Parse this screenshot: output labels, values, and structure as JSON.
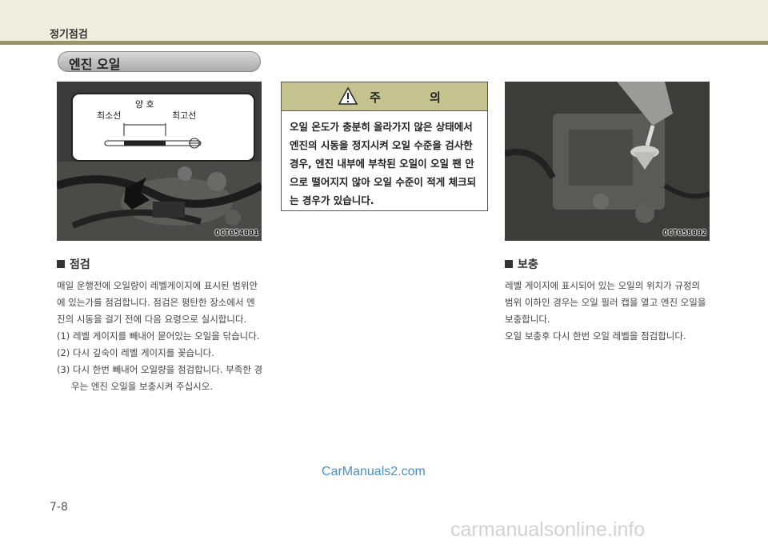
{
  "header": {
    "title": "정기점검"
  },
  "section": {
    "title": "엔진 오일"
  },
  "left_photo": {
    "code": "OCT054001",
    "inset_label_good": "양 호",
    "inset_label_min": "최소선",
    "inset_label_max": "최고선"
  },
  "caution": {
    "title": "주 의",
    "text": "오일 온도가 충분히 올라가지 않은 상태에서 엔진의 시동을 정지시켜 오일 수준을 검사한 경우, 엔진 내부에 부착된 오일이 오일 팬 안으로 떨어지지 않아 오일 수준이 적게 체크되는 경우가 있습니다."
  },
  "right_photo": {
    "code": "OCT058002"
  },
  "inspection": {
    "heading": "점검",
    "intro": "매일 운행전에 오일량이 레벨게이지에 표시된 범위안에 있는가를 점검합니다. 점검은 평탄한 장소에서 엔진의 시동을 걸기 전에 다음 요령으로 실시합니다.",
    "steps": [
      "(1) 레벨 게이지를 빼내어 묻어있는 오일을 닦습니다.",
      "(2) 다시 깊숙이 레벨 게이지를 꽂습니다.",
      "(3) 다시 한번 빼내어 오일량을 점검합니다. 부족한 경우는 엔진 오일을 보충시켜 주십시오."
    ]
  },
  "refill": {
    "heading": "보충",
    "para1": "레벨 게이지에 표시되어 있는 오일의 위치가 규정의 범위 이하인 경우는 오일 필러 캡을 열고 엔진 오일을 보충합니다.",
    "para2": "오일 보충후 다시 한번 오일 레벨을 점검합니다."
  },
  "watermark": "CarManuals2.com",
  "footer_site": "carmanualsonline.info",
  "page_number": "7-8"
}
